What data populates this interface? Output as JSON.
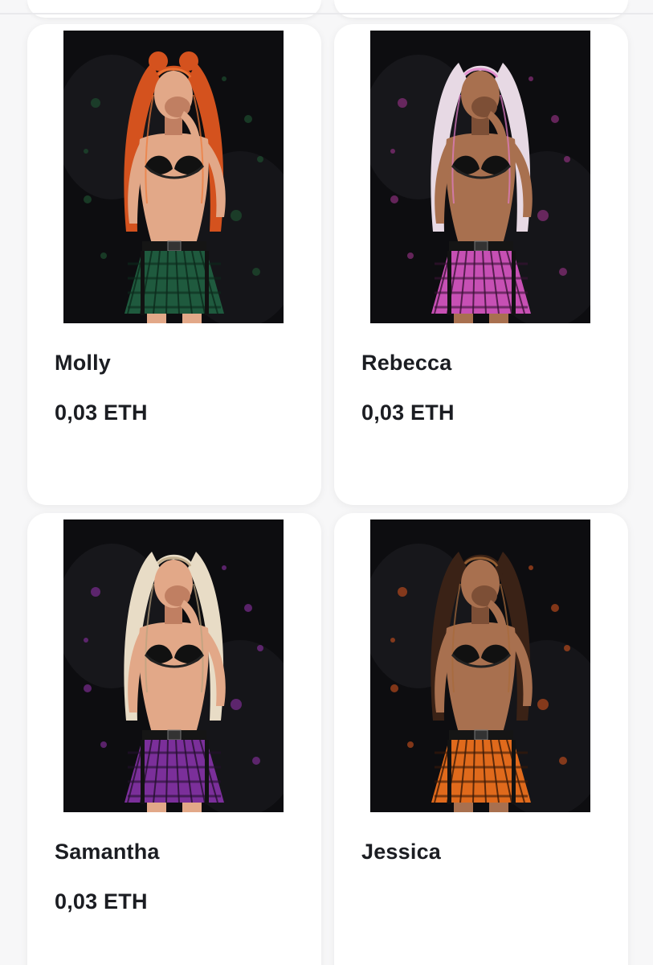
{
  "cards": [
    {
      "name": "Molly",
      "price": "0,03 ETH",
      "hair": "#d4521e",
      "hair_hi": "#f07a3a",
      "skirt": "#1f5a3e",
      "skirt_line": "#0c2a1c",
      "splash": "#1e4d2f"
    },
    {
      "name": "Rebecca",
      "price": "0,03 ETH",
      "hair": "#e7d9e4",
      "hair_hi": "#e27dc9",
      "skirt": "#c750b4",
      "skirt_line": "#3a1236",
      "splash": "#8a2f7a"
    },
    {
      "name": "Samantha",
      "price": "0,03 ETH",
      "hair": "#e8dcc6",
      "hair_hi": "#b9a27f",
      "skirt": "#7b2f9a",
      "skirt_line": "#24102e",
      "splash": "#7a2c90"
    },
    {
      "name": "Jessica",
      "price": "",
      "hair": "#3a2216",
      "hair_hi": "#a86b3a",
      "skirt": "#e06a1c",
      "skirt_line": "#3a1a08",
      "splash": "#b4491c"
    }
  ]
}
